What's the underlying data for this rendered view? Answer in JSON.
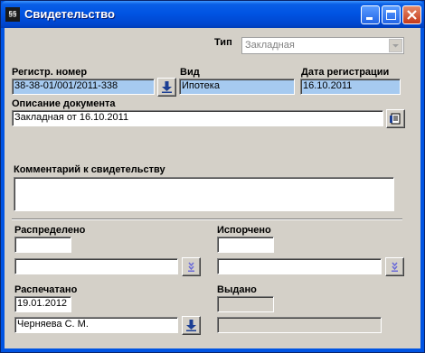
{
  "window": {
    "title": "Свидетельство",
    "icon": "app-icon",
    "icon_text": "§§"
  },
  "type": {
    "label": "Тип",
    "value": "Закладная"
  },
  "reg_number": {
    "label": "Регистр. номер",
    "value": "38-38-01/001/2011-338"
  },
  "kind": {
    "label": "Вид",
    "value": "Ипотека"
  },
  "reg_date": {
    "label": "Дата регистрации",
    "value": "16.10.2011"
  },
  "doc_desc": {
    "label": "Описание документа",
    "value": "Закладная от 16.10.2011"
  },
  "comment": {
    "label": "Комментарий к свидетельству",
    "value": ""
  },
  "distributed": {
    "label": "Распределено",
    "value": "",
    "person": ""
  },
  "spoiled": {
    "label": "Испорчено",
    "value": "",
    "person": ""
  },
  "printed": {
    "label": "Распечатано",
    "value": "19.01.2012",
    "person": "Черняева С. М."
  },
  "issued": {
    "label": "Выдано",
    "value": "",
    "person": ""
  }
}
